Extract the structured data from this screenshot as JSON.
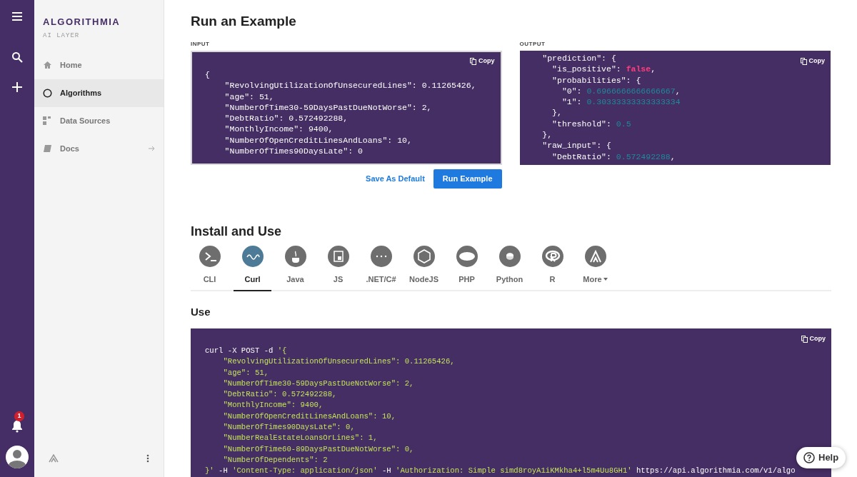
{
  "brand": {
    "name": "ALGORITHMIA",
    "tagline": "AI LAYER"
  },
  "notifications": {
    "count": "1"
  },
  "sidebar": {
    "items": [
      {
        "label": "Home",
        "selected": false,
        "has_arrow": false
      },
      {
        "label": "Algorithms",
        "selected": true,
        "has_arrow": false
      },
      {
        "label": "Data Sources",
        "selected": false,
        "has_arrow": false
      },
      {
        "label": "Docs",
        "selected": false,
        "has_arrow": true
      }
    ]
  },
  "example": {
    "title": "Run an Example",
    "input": {
      "label": "INPUT",
      "copy": "Copy",
      "lines": [
        [
          {
            "text": "{",
            "kind": "plain"
          }
        ],
        [
          {
            "text": "    \"RevolvingUtilizationOfUnsecuredLines\": 0.11265426,",
            "kind": "plain"
          }
        ],
        [
          {
            "text": "    \"age\": 51,",
            "kind": "plain"
          }
        ],
        [
          {
            "text": "    \"NumberOfTime30-59DaysPastDueNotWorse\": 2,",
            "kind": "plain"
          }
        ],
        [
          {
            "text": "    \"DebtRatio\": 0.572492288,",
            "kind": "plain"
          }
        ],
        [
          {
            "text": "    \"MonthlyIncome\": 9400,",
            "kind": "plain"
          }
        ],
        [
          {
            "text": "    \"NumberOfOpenCreditLinesAndLoans\": 10,",
            "kind": "plain"
          }
        ],
        [
          {
            "text": "    \"NumberOfTimes90DaysLate\": 0",
            "kind": "plain"
          }
        ]
      ]
    },
    "output": {
      "label": "OUTPUT",
      "copy": "Copy",
      "lines": [
        [
          {
            "text": "  \"prediction\": {",
            "kind": "plain"
          }
        ],
        [
          {
            "text": "    \"is_positive\": ",
            "kind": "plain"
          },
          {
            "text": "false",
            "kind": "bool"
          },
          {
            "text": ",",
            "kind": "plain"
          }
        ],
        [
          {
            "text": "    \"probabilities\": {",
            "kind": "plain"
          }
        ],
        [
          {
            "text": "      \"0\": ",
            "kind": "plain"
          },
          {
            "text": "0.6966666666666667",
            "kind": "number"
          },
          {
            "text": ",",
            "kind": "plain"
          }
        ],
        [
          {
            "text": "      \"1\": ",
            "kind": "plain"
          },
          {
            "text": "0.30333333333333334",
            "kind": "number"
          }
        ],
        [
          {
            "text": "    },",
            "kind": "plain"
          }
        ],
        [
          {
            "text": "    \"threshold\": ",
            "kind": "plain"
          },
          {
            "text": "0.5",
            "kind": "number"
          }
        ],
        [
          {
            "text": "  },",
            "kind": "plain"
          }
        ],
        [
          {
            "text": "  \"raw_input\": {",
            "kind": "plain"
          }
        ],
        [
          {
            "text": "    \"DebtRatio\": ",
            "kind": "plain"
          },
          {
            "text": "0.572492288",
            "kind": "number"
          },
          {
            "text": ",",
            "kind": "plain"
          }
        ]
      ]
    },
    "buttons": [
      {
        "label": "Save As Default",
        "kind": "link"
      },
      {
        "label": "Run Example",
        "kind": "primary"
      }
    ]
  },
  "install": {
    "title": "Install and Use",
    "tabs": [
      {
        "label": "CLI",
        "selected": false,
        "dropdown": false
      },
      {
        "label": "Curl",
        "selected": true,
        "dropdown": false
      },
      {
        "label": "Java",
        "selected": false,
        "dropdown": false
      },
      {
        "label": "JS",
        "selected": false,
        "dropdown": false
      },
      {
        "label": ".NET/C#",
        "selected": false,
        "dropdown": false
      },
      {
        "label": "NodeJS",
        "selected": false,
        "dropdown": false
      },
      {
        "label": "PHP",
        "selected": false,
        "dropdown": false
      },
      {
        "label": "Python",
        "selected": false,
        "dropdown": false
      },
      {
        "label": "R",
        "selected": false,
        "dropdown": false
      },
      {
        "label": "More",
        "selected": false,
        "dropdown": true
      }
    ],
    "use": {
      "title": "Use",
      "copy": "Copy",
      "lines": [
        [
          {
            "text": "curl -X POST -d ",
            "kind": "plain"
          },
          {
            "text": "'{",
            "kind": "string"
          }
        ],
        [
          {
            "text": "    \"RevolvingUtilizationOfUnsecuredLines\": 0.11265426,",
            "kind": "string"
          }
        ],
        [
          {
            "text": "    \"age\": 51,",
            "kind": "string"
          }
        ],
        [
          {
            "text": "    \"NumberOfTime30-59DaysPastDueNotWorse\": 2,",
            "kind": "string"
          }
        ],
        [
          {
            "text": "    \"DebtRatio\": 0.572492288,",
            "kind": "string"
          }
        ],
        [
          {
            "text": "    \"MonthlyIncome\": 9400,",
            "kind": "string"
          }
        ],
        [
          {
            "text": "    \"NumberOfOpenCreditLinesAndLoans\": 10,",
            "kind": "string"
          }
        ],
        [
          {
            "text": "    \"NumberOfTimes90DaysLate\": 0,",
            "kind": "string"
          }
        ],
        [
          {
            "text": "    \"NumberRealEstateLoansOrLines\": 1,",
            "kind": "string"
          }
        ],
        [
          {
            "text": "    \"NumberOfTime60-89DaysPastDueNotWorse\": 0,",
            "kind": "string"
          }
        ],
        [
          {
            "text": "    \"NumberOfDependents\": 2",
            "kind": "string"
          }
        ],
        [
          {
            "text": "}'",
            "kind": "string"
          },
          {
            "text": " -H ",
            "kind": "plain"
          },
          {
            "text": "'Content-Type: application/json'",
            "kind": "string"
          },
          {
            "text": " -H ",
            "kind": "plain"
          },
          {
            "text": "'Authorization: Simple simd8royA1iKMkha4+l5m4Uu8GH1'",
            "kind": "string"
          },
          {
            "text": " https://api.algorithmia.com/v1/algo",
            "kind": "plain"
          }
        ]
      ]
    }
  },
  "help": {
    "label": "Help"
  }
}
